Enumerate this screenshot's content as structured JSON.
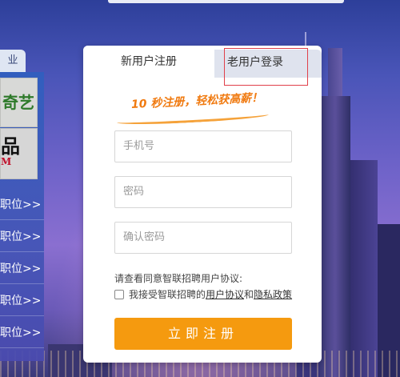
{
  "left_sidebar": {
    "tab_label": "业",
    "card1_text": "奇艺",
    "card2_text": "品",
    "card2_sub": "M",
    "job_links": [
      "职位>>",
      "职位>>",
      "职位>>",
      "职位>>",
      "职位>>"
    ]
  },
  "form": {
    "tabs": {
      "register": "新用户注册",
      "login": "老用户登录"
    },
    "slogan": "10 秒注册，轻松获高薪！",
    "fields": {
      "phone_placeholder": "手机号",
      "password_placeholder": "密码",
      "confirm_placeholder": "确认密码"
    },
    "agreement": {
      "prompt": "请查看同意智联招聘用户协议:",
      "prefix": "我接受智联招聘的",
      "user_agreement": "用户协议",
      "and": "和",
      "privacy_policy": "隐私政策"
    },
    "submit_label": "立即注册"
  },
  "colors": {
    "accent_orange": "#f59a0f",
    "slogan_orange": "#f07a10",
    "highlight_red": "#e0404a"
  }
}
